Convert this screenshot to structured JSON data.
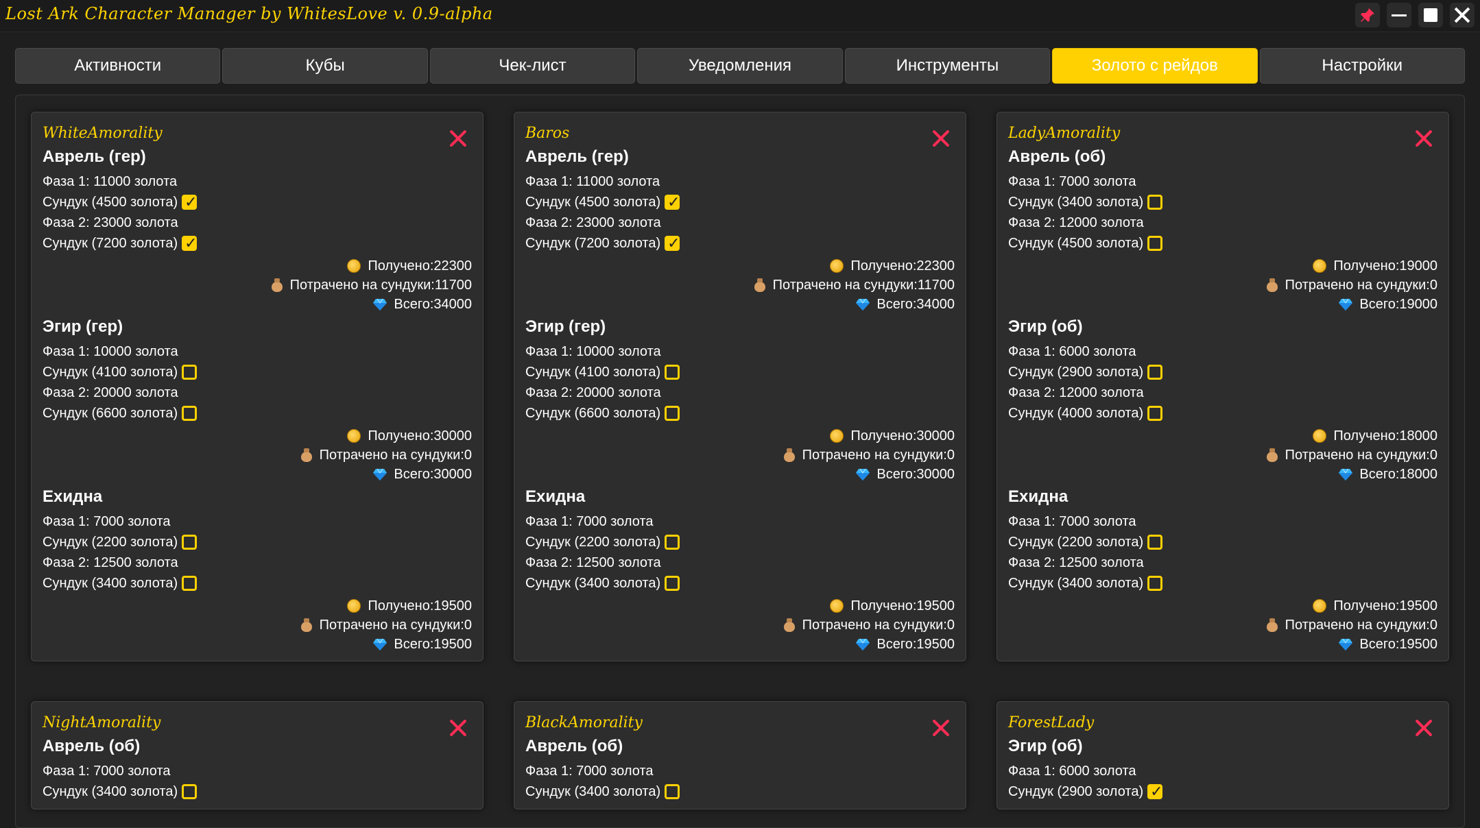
{
  "app": {
    "title": "Lost Ark Character Manager by WhitesLove v. 0.9-alpha"
  },
  "window_controls": [
    "pin-icon",
    "minimize-icon",
    "maximize-icon",
    "close-icon"
  ],
  "tabs": [
    {
      "label": "Активности",
      "active": false
    },
    {
      "label": "Кубы",
      "active": false
    },
    {
      "label": "Чек-лист",
      "active": false
    },
    {
      "label": "Уведомления",
      "active": false
    },
    {
      "label": "Инструменты",
      "active": false
    },
    {
      "label": "Золото с рейдов",
      "active": true
    },
    {
      "label": "Настройки",
      "active": false
    }
  ],
  "labels": {
    "received": "Получено: ",
    "spent": "Потрачено на сундуки: ",
    "total": "Всего: "
  },
  "colors": {
    "accent": "#ffd100",
    "name": "#ffd400",
    "remove": "#ff2d55"
  },
  "characters": [
    {
      "name": "WhiteAmorality",
      "raids": [
        {
          "title": "Аврель (гер)",
          "phase1": "Фаза 1: 11000 золота",
          "chest1": "Сундук (4500 золота)",
          "chest1_checked": true,
          "phase2": "Фаза 2: 23000 золота",
          "chest2": "Сундук (7200 золота)",
          "chest2_checked": true,
          "received": "22300",
          "spent": "11700",
          "total": "34000"
        },
        {
          "title": "Эгир (гер)",
          "phase1": "Фаза 1: 10000 золота",
          "chest1": "Сундук (4100 золота)",
          "chest1_checked": false,
          "phase2": "Фаза 2: 20000 золота",
          "chest2": "Сундук (6600 золота)",
          "chest2_checked": false,
          "received": "30000",
          "spent": "0",
          "total": "30000"
        },
        {
          "title": "Ехидна",
          "phase1": "Фаза 1: 7000 золота",
          "chest1": "Сундук (2200 золота)",
          "chest1_checked": false,
          "phase2": "Фаза 2: 12500 золота",
          "chest2": "Сундук (3400 золота)",
          "chest2_checked": false,
          "received": "19500",
          "spent": "0",
          "total": "19500"
        }
      ]
    },
    {
      "name": "Baros",
      "raids": [
        {
          "title": "Аврель (гер)",
          "phase1": "Фаза 1: 11000 золота",
          "chest1": "Сундук (4500 золота)",
          "chest1_checked": true,
          "phase2": "Фаза 2: 23000 золота",
          "chest2": "Сундук (7200 золота)",
          "chest2_checked": true,
          "received": "22300",
          "spent": "11700",
          "total": "34000"
        },
        {
          "title": "Эгир (гер)",
          "phase1": "Фаза 1: 10000 золота",
          "chest1": "Сундук (4100 золота)",
          "chest1_checked": false,
          "phase2": "Фаза 2: 20000 золота",
          "chest2": "Сундук (6600 золота)",
          "chest2_checked": false,
          "received": "30000",
          "spent": "0",
          "total": "30000"
        },
        {
          "title": "Ехидна",
          "phase1": "Фаза 1: 7000 золота",
          "chest1": "Сундук (2200 золота)",
          "chest1_checked": false,
          "phase2": "Фаза 2: 12500 золота",
          "chest2": "Сундук (3400 золота)",
          "chest2_checked": false,
          "received": "19500",
          "spent": "0",
          "total": "19500"
        }
      ]
    },
    {
      "name": "LadyAmorality",
      "raids": [
        {
          "title": "Аврель (об)",
          "phase1": "Фаза 1: 7000 золота",
          "chest1": "Сундук (3400 золота)",
          "chest1_checked": false,
          "phase2": "Фаза 2: 12000 золота",
          "chest2": "Сундук (4500 золота)",
          "chest2_checked": false,
          "received": "19000",
          "spent": "0",
          "total": "19000"
        },
        {
          "title": "Эгир (об)",
          "phase1": "Фаза 1: 6000 золота",
          "chest1": "Сундук (2900 золота)",
          "chest1_checked": false,
          "phase2": "Фаза 2: 12000 золота",
          "chest2": "Сундук (4000 золота)",
          "chest2_checked": false,
          "received": "18000",
          "spent": "0",
          "total": "18000"
        },
        {
          "title": "Ехидна",
          "phase1": "Фаза 1: 7000 золота",
          "chest1": "Сундук (2200 золота)",
          "chest1_checked": false,
          "phase2": "Фаза 2: 12500 золота",
          "chest2": "Сундук (3400 золота)",
          "chest2_checked": false,
          "received": "19500",
          "spent": "0",
          "total": "19500"
        }
      ]
    },
    {
      "name": "NightAmorality",
      "raids": [
        {
          "title": "Аврель (об)",
          "phase1": "Фаза 1: 7000 золота",
          "chest1": "Сундук (3400 золота)",
          "chest1_checked": false
        }
      ]
    },
    {
      "name": "BlackAmorality",
      "raids": [
        {
          "title": "Аврель (об)",
          "phase1": "Фаза 1: 7000 золота",
          "chest1": "Сундук (3400 золота)",
          "chest1_checked": false
        }
      ]
    },
    {
      "name": "ForestLady",
      "raids": [
        {
          "title": "Эгир (об)",
          "phase1": "Фаза 1: 6000 золота",
          "chest1": "Сундук (2900 золота)",
          "chest1_checked": true
        }
      ]
    }
  ]
}
